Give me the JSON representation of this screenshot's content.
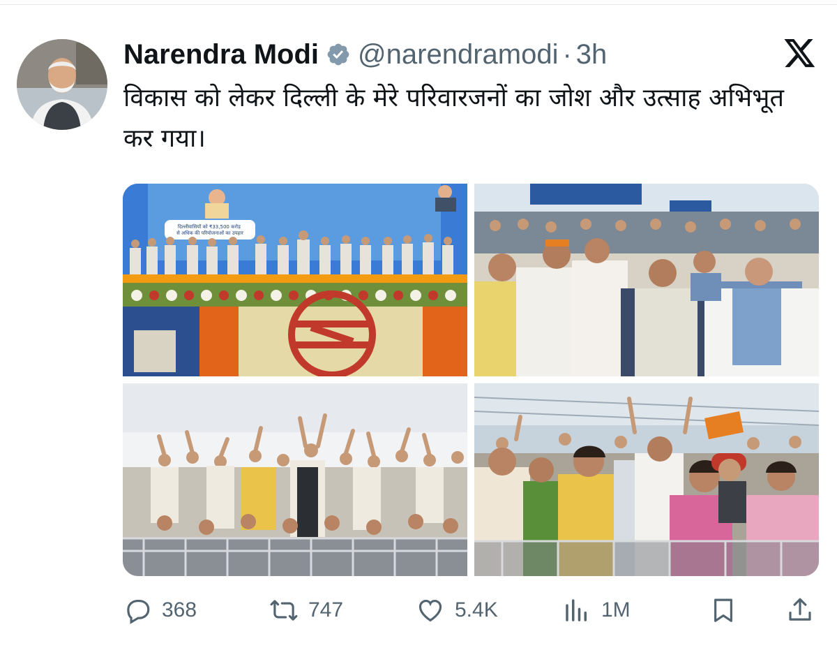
{
  "tweet": {
    "author": {
      "name": "Narendra Modi",
      "handle": "@narendramodi",
      "verified": true
    },
    "separator": "·",
    "time": "3h",
    "text": "विकास को लेकर दिल्ली के मेरे परिवारजनों का जोश और उत्साह अभिभूत कर गया।",
    "media": [
      {
        "label": "Stage event with metro logo flower arrangement",
        "banner_text": "दिल्लीवासियों को ₹33,500 करोड़ से अधिक की परियोजनाओं का उपहार"
      },
      {
        "label": "Audience cheering in front row"
      },
      {
        "label": "Crowd raising hands"
      },
      {
        "label": "Women clapping in audience"
      }
    ],
    "actions": {
      "replies": "368",
      "reposts": "747",
      "likes": "5.4K",
      "views": "1M"
    }
  },
  "colors": {
    "text": "#0f1419",
    "muted": "#536471",
    "verified": "#829aab"
  },
  "icons": [
    "verified-badge-icon",
    "x-logo-icon",
    "reply-icon",
    "repost-icon",
    "like-icon",
    "views-icon",
    "bookmark-icon",
    "share-icon"
  ]
}
